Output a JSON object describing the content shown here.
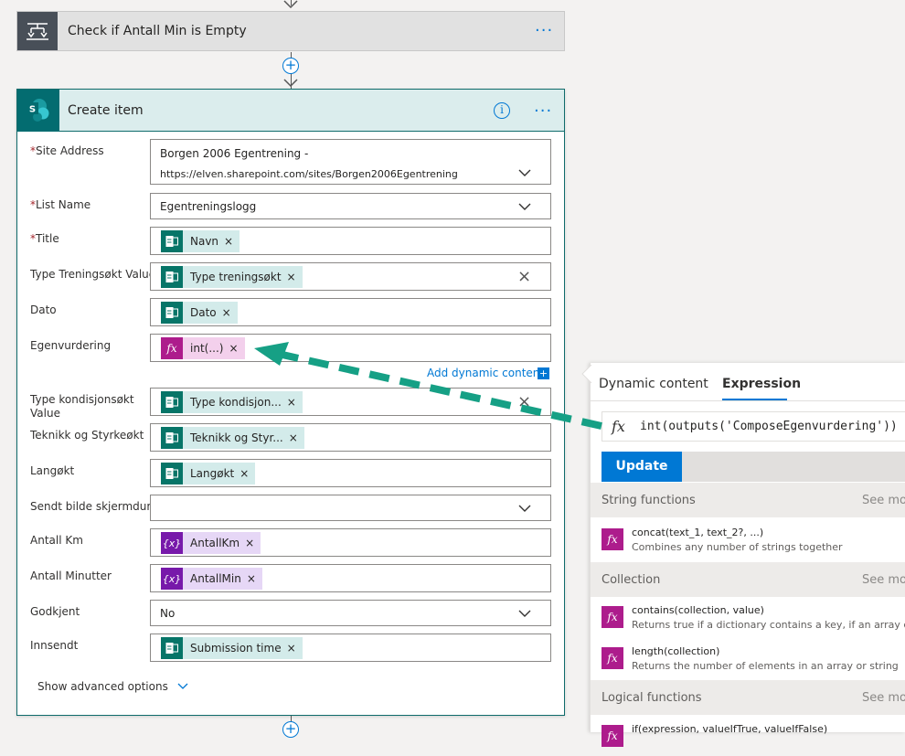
{
  "condition_card": {
    "title": "Check if Antall Min is Empty",
    "more": "···"
  },
  "create_item": {
    "title": "Create item",
    "more": "···",
    "info": "i",
    "fields": {
      "site_address": {
        "label": "Site Address",
        "required": "*",
        "value_line1": "Borgen 2006 Egentrening -",
        "value_line2": "https://elven.sharepoint.com/sites/Borgen2006Egentrening"
      },
      "list_name": {
        "label": "List Name",
        "required": "*",
        "value": "Egentreningslogg"
      },
      "title": {
        "label": "Title",
        "required": "*",
        "token": "Navn"
      },
      "type_trening": {
        "label": "Type Treningsøkt Value",
        "token": "Type treningsøkt"
      },
      "dato": {
        "label": "Dato",
        "token": "Dato"
      },
      "egenvurdering": {
        "label": "Egenvurdering",
        "token": "int(...)"
      },
      "type_kondisjon": {
        "label_line1": "Type kondisjonsøkt",
        "label_line2": "Value",
        "token": "Type kondisjon..."
      },
      "teknikk": {
        "label": "Teknikk og Styrkeøkt",
        "token": "Teknikk og Styr..."
      },
      "langokt": {
        "label": "Langøkt",
        "token": "Langøkt"
      },
      "sendt_bilde": {
        "label": "Sendt bilde skjermdump",
        "value": ""
      },
      "antall_km": {
        "label": "Antall Km",
        "token": "AntallKm"
      },
      "antall_min": {
        "label": "Antall Minutter",
        "token": "AntallMin"
      },
      "godkjent": {
        "label": "Godkjent",
        "value": "No"
      },
      "innsendt": {
        "label": "Innsendt",
        "token": "Submission time"
      }
    },
    "add_dynamic": "Add dynamic content",
    "add_dynamic_icon": "+",
    "show_advanced": "Show advanced options"
  },
  "token_close": "×",
  "icons": {
    "fx": "fx",
    "var": "{x}",
    "sp_letter": "S",
    "clear": "×"
  },
  "panel": {
    "tabs": [
      "Dynamic content",
      "Expression"
    ],
    "expression": "int(outputs('ComposeEgenvurdering'))",
    "update_label": "Update",
    "sections": [
      {
        "title": "String functions",
        "more": "See more"
      },
      {
        "title": "Collection",
        "more": "See more"
      },
      {
        "title": "Logical functions",
        "more": "See more"
      }
    ],
    "functions": [
      {
        "name": "concat(text_1, text_2?, ...)",
        "desc": "Combines any number of strings together"
      },
      {
        "name": "contains(collection, value)",
        "desc": "Returns true if a dictionary contains a key, if an array contains a value"
      },
      {
        "name": "length(collection)",
        "desc": "Returns the number of elements in an array or string"
      },
      {
        "name": "if(expression, valueIfTrue, valueIfFalse)",
        "desc": ""
      }
    ]
  },
  "colors": {
    "accent_blue": "#0078d4",
    "sharepoint_teal": "#077568",
    "expression_pink": "#ad1c8c",
    "variable_purple": "#7719aa",
    "annotation_arrow": "#16a085"
  }
}
